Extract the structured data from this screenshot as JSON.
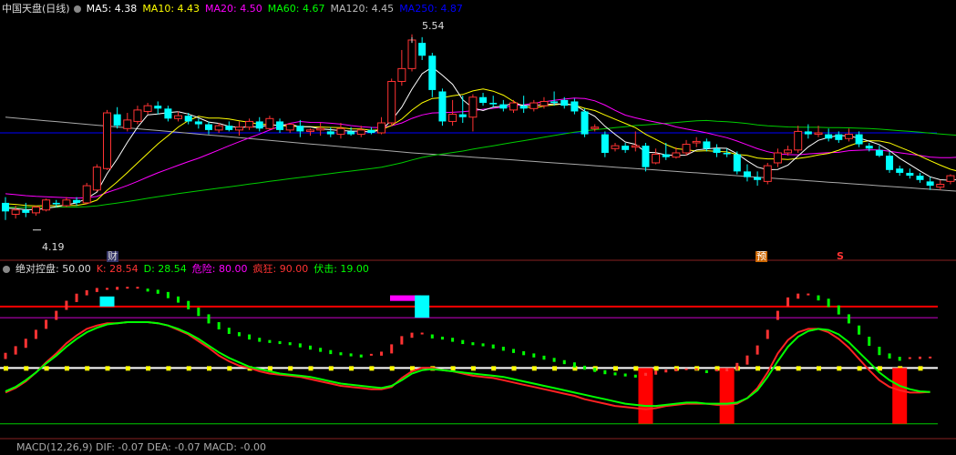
{
  "main_header": {
    "title": "中国天盘(日线)",
    "items": [
      {
        "label": "MA5:",
        "value": "4.38",
        "color": "#ffffff"
      },
      {
        "label": "MA10:",
        "value": "4.43",
        "color": "#ffff00"
      },
      {
        "label": "MA20:",
        "value": "4.50",
        "color": "#ff00ff"
      },
      {
        "label": "MA60:",
        "value": "4.67",
        "color": "#00ff00"
      },
      {
        "label": "MA120:",
        "value": "4.45",
        "color": "#bbbbbb"
      },
      {
        "label": "MA250:",
        "value": "4.87",
        "color": "#0000ff"
      }
    ]
  },
  "sub_header": {
    "title": "绝对控盘",
    "value": ": 50.00",
    "items": [
      {
        "label": "K:",
        "value": "28.54",
        "color": "#ff3333"
      },
      {
        "label": "D:",
        "value": "28.54",
        "color": "#00ff00"
      },
      {
        "label": "危险:",
        "value": "80.00",
        "color": "#ff00ff"
      },
      {
        "label": "疯狂:",
        "value": "90.00",
        "color": "#ff3333"
      },
      {
        "label": "伏击:",
        "value": "19.00",
        "color": "#00ff00"
      }
    ]
  },
  "bottom_header": {
    "text": "MACD(12,26,9) DIF: -0.07 DEA: -0.07 MACD: -0.00"
  },
  "markers": {
    "cai": "财",
    "yu": "预",
    "s": "S",
    "high": "5.54",
    "low": "4.19"
  },
  "chart_data": [
    {
      "type": "candlestick",
      "ylim": [
        4.08,
        5.66
      ],
      "high_label": 5.54,
      "low_label": 4.19,
      "ma_last": {
        "MA5": 4.38,
        "MA10": 4.43,
        "MA20": 4.5,
        "MA60": 4.67,
        "MA120": 4.45,
        "MA250": 4.87
      },
      "candles": [
        [
          4.38,
          4.32,
          4.42,
          4.26
        ],
        [
          4.3,
          4.33,
          4.36,
          4.27
        ],
        [
          4.33,
          4.31,
          4.38,
          4.28
        ],
        [
          4.31,
          4.35,
          4.36,
          4.29
        ],
        [
          4.33,
          4.4,
          4.41,
          4.32
        ],
        [
          4.38,
          4.37,
          4.4,
          4.35
        ],
        [
          4.36,
          4.4,
          4.42,
          4.35
        ],
        [
          4.4,
          4.38,
          4.42,
          4.36
        ],
        [
          4.38,
          4.5,
          4.52,
          4.37
        ],
        [
          4.47,
          4.63,
          4.65,
          4.46
        ],
        [
          4.62,
          5.01,
          5.03,
          4.61
        ],
        [
          5.0,
          4.92,
          5.05,
          4.9
        ],
        [
          4.9,
          4.96,
          5.01,
          4.88
        ],
        [
          4.95,
          5.03,
          5.06,
          4.93
        ],
        [
          5.02,
          5.06,
          5.08,
          5.0
        ],
        [
          5.06,
          5.04,
          5.09,
          5.0
        ],
        [
          5.04,
          4.97,
          5.06,
          4.95
        ],
        [
          4.97,
          4.99,
          5.02,
          4.95
        ],
        [
          4.99,
          4.95,
          5.01,
          4.93
        ],
        [
          4.95,
          4.93,
          4.97,
          4.9
        ],
        [
          4.93,
          4.89,
          4.95,
          4.86
        ],
        [
          4.89,
          4.92,
          4.94,
          4.87
        ],
        [
          4.92,
          4.89,
          4.95,
          4.88
        ],
        [
          4.89,
          4.91,
          4.95,
          4.85
        ],
        [
          4.91,
          4.95,
          4.97,
          4.89
        ],
        [
          4.95,
          4.9,
          4.98,
          4.88
        ],
        [
          4.9,
          4.97,
          4.99,
          4.89
        ],
        [
          4.95,
          4.89,
          4.97,
          4.87
        ],
        [
          4.89,
          4.93,
          4.94,
          4.87
        ],
        [
          4.92,
          4.88,
          4.96,
          4.84
        ],
        [
          4.88,
          4.89,
          4.9,
          4.85
        ],
        [
          4.89,
          4.9,
          4.94,
          4.85
        ],
        [
          4.88,
          4.86,
          4.91,
          4.84
        ],
        [
          4.86,
          4.9,
          4.94,
          4.83
        ],
        [
          4.88,
          4.86,
          4.91,
          4.85
        ],
        [
          4.86,
          4.89,
          4.92,
          4.84
        ],
        [
          4.89,
          4.87,
          4.91,
          4.86
        ],
        [
          4.87,
          4.94,
          4.98,
          4.86
        ],
        [
          4.94,
          5.23,
          5.25,
          4.92
        ],
        [
          5.23,
          5.32,
          5.45,
          5.2
        ],
        [
          5.32,
          5.52,
          5.56,
          5.3
        ],
        [
          5.5,
          5.41,
          5.54,
          5.38
        ],
        [
          5.41,
          5.17,
          5.43,
          5.12
        ],
        [
          5.16,
          4.95,
          5.18,
          4.92
        ],
        [
          4.95,
          5.0,
          5.1,
          4.92
        ],
        [
          5.0,
          4.98,
          5.13,
          4.94
        ],
        [
          4.98,
          5.12,
          5.14,
          4.88
        ],
        [
          5.12,
          5.08,
          5.15,
          5.06
        ],
        [
          5.08,
          5.07,
          5.13,
          5.05
        ],
        [
          5.07,
          5.04,
          5.1,
          5.02
        ],
        [
          5.03,
          5.08,
          5.1,
          5.01
        ],
        [
          5.06,
          5.04,
          5.13,
          5.01
        ],
        [
          5.04,
          5.08,
          5.1,
          5.02
        ],
        [
          5.06,
          5.09,
          5.12,
          5.04
        ],
        [
          5.09,
          5.08,
          5.16,
          5.06
        ],
        [
          5.1,
          5.06,
          5.12,
          5.04
        ],
        [
          5.09,
          5.02,
          5.11,
          5.0
        ],
        [
          5.02,
          4.86,
          5.04,
          4.84
        ],
        [
          4.9,
          4.91,
          4.93,
          4.88
        ],
        [
          4.86,
          4.73,
          4.88,
          4.7
        ],
        [
          4.76,
          4.78,
          4.8,
          4.74
        ],
        [
          4.78,
          4.75,
          4.8,
          4.73
        ],
        [
          4.77,
          4.78,
          4.88,
          4.74
        ],
        [
          4.78,
          4.63,
          4.8,
          4.6
        ],
        [
          4.66,
          4.72,
          4.76,
          4.65
        ],
        [
          4.72,
          4.7,
          4.8,
          4.68
        ],
        [
          4.7,
          4.73,
          4.77,
          4.69
        ],
        [
          4.73,
          4.79,
          4.82,
          4.71
        ],
        [
          4.8,
          4.81,
          4.84,
          4.77
        ],
        [
          4.81,
          4.76,
          4.83,
          4.74
        ],
        [
          4.76,
          4.73,
          4.79,
          4.7
        ],
        [
          4.73,
          4.72,
          4.76,
          4.7
        ],
        [
          4.72,
          4.6,
          4.74,
          4.58
        ],
        [
          4.6,
          4.56,
          4.65,
          4.53
        ],
        [
          4.56,
          4.54,
          4.6,
          4.5
        ],
        [
          4.53,
          4.64,
          4.66,
          4.51
        ],
        [
          4.66,
          4.73,
          4.76,
          4.63
        ],
        [
          4.73,
          4.75,
          4.78,
          4.71
        ],
        [
          4.75,
          4.88,
          4.92,
          4.73
        ],
        [
          4.88,
          4.86,
          4.93,
          4.83
        ],
        [
          4.86,
          4.87,
          4.92,
          4.84
        ],
        [
          4.86,
          4.83,
          4.9,
          4.81
        ],
        [
          4.86,
          4.82,
          4.88,
          4.8
        ],
        [
          4.83,
          4.86,
          4.9,
          4.81
        ],
        [
          4.86,
          4.79,
          4.88,
          4.77
        ],
        [
          4.78,
          4.76,
          4.8,
          4.74
        ],
        [
          4.75,
          4.71,
          4.78,
          4.7
        ],
        [
          4.71,
          4.61,
          4.74,
          4.59
        ],
        [
          4.62,
          4.59,
          4.64,
          4.57
        ],
        [
          4.59,
          4.57,
          4.62,
          4.55
        ],
        [
          4.57,
          4.54,
          4.59,
          4.52
        ],
        [
          4.53,
          4.5,
          4.56,
          4.47
        ],
        [
          4.49,
          4.51,
          4.54,
          4.47
        ],
        [
          4.53,
          4.57,
          4.58,
          4.51
        ],
        [
          4.58,
          4.61,
          4.63,
          4.56
        ],
        [
          4.62,
          4.58,
          4.64,
          4.51
        ]
      ]
    },
    {
      "type": "line",
      "ylim": [
        -10,
        135
      ],
      "levels": {
        "危险": 80,
        "疯狂": 90,
        "中线": 50,
        "伏击": 19
      },
      "K": [
        28,
        32,
        38,
        46,
        55,
        63,
        72,
        79,
        85,
        88,
        90,
        90,
        91,
        91,
        91,
        90,
        88,
        84,
        80,
        74,
        68,
        61,
        56,
        52,
        50,
        47,
        45,
        44,
        43,
        42,
        40,
        38,
        36,
        34,
        33,
        32,
        31,
        31,
        33,
        41,
        47,
        50,
        50,
        48,
        47,
        45,
        43,
        42,
        41,
        39,
        37,
        35,
        33,
        31,
        29,
        27,
        25,
        22,
        20,
        18,
        16,
        15,
        14,
        13,
        14,
        16,
        17,
        18,
        18,
        18,
        17,
        17,
        18,
        23,
        32,
        46,
        63,
        75,
        82,
        85,
        85,
        82,
        76,
        68,
        58,
        48,
        39,
        33,
        30,
        28,
        28,
        28.54
      ],
      "D": [
        29,
        33,
        39,
        46,
        54,
        61,
        69,
        76,
        82,
        86,
        89,
        90,
        91,
        91,
        91,
        90,
        88,
        85,
        81,
        76,
        70,
        64,
        59,
        55,
        51,
        49,
        47,
        45,
        44,
        43,
        42,
        40,
        38,
        36,
        35,
        34,
        33,
        32,
        34,
        39,
        45,
        48,
        49,
        48,
        47,
        46,
        45,
        44,
        43,
        42,
        40,
        38,
        36,
        34,
        32,
        30,
        28,
        26,
        24,
        22,
        20,
        18,
        17,
        16,
        16,
        17,
        18,
        19,
        19,
        18,
        18,
        18,
        19,
        23,
        30,
        42,
        56,
        69,
        78,
        83,
        85,
        84,
        80,
        73,
        64,
        55,
        46,
        39,
        34,
        31,
        29,
        28.54
      ],
      "bars": [
        {
          "index": 10,
          "color": "#00ffff",
          "range": [
            90,
            99
          ]
        },
        {
          "index": 40,
          "color": "#ff00ff",
          "range": [
            95,
            100
          ]
        },
        {
          "index": 41,
          "color": "#00ffff",
          "range": [
            80,
            100
          ]
        },
        {
          "index": 63,
          "color": "#ff0000",
          "range": [
            0,
            50
          ]
        },
        {
          "index": 71,
          "color": "#ff0000",
          "range": [
            0,
            50
          ]
        },
        {
          "index": 88,
          "color": "#ff0000",
          "range": [
            0,
            50
          ]
        }
      ]
    }
  ]
}
